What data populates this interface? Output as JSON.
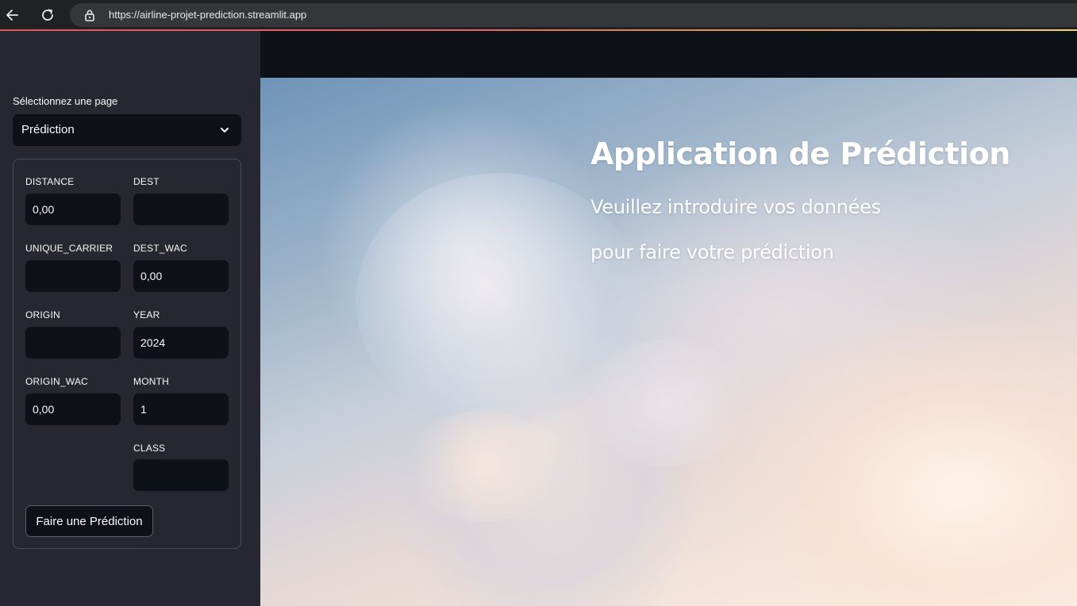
{
  "browser": {
    "url": "https://airline-projet-prediction.streamlit.app"
  },
  "sidebar": {
    "page_select_label": "Sélectionnez une page",
    "page_select_value": "Prédiction",
    "form": {
      "distance_label": "DISTANCE",
      "distance_value": "0,00",
      "dest_label": "DEST",
      "dest_value": "",
      "unique_carrier_label": "UNIQUE_CARRIER",
      "unique_carrier_value": "",
      "dest_wac_label": "DEST_WAC",
      "dest_wac_value": "0,00",
      "origin_label": "ORIGIN",
      "origin_value": "",
      "year_label": "YEAR",
      "year_value": "2024",
      "origin_wac_label": "ORIGIN_WAC",
      "origin_wac_value": "0,00",
      "month_label": "MONTH",
      "month_value": "1",
      "class_label": "CLASS",
      "class_value": "",
      "submit_label": "Faire une Prédiction"
    }
  },
  "main": {
    "title": "Application de Prédiction",
    "subtitle_line1": "Veuillez introduire vos données",
    "subtitle_line2": "pour faire votre prédiction"
  },
  "colors": {
    "sidebar_bg": "#262730",
    "input_bg": "#0e1117",
    "text": "#fafafa",
    "border": "#4a4c57"
  }
}
